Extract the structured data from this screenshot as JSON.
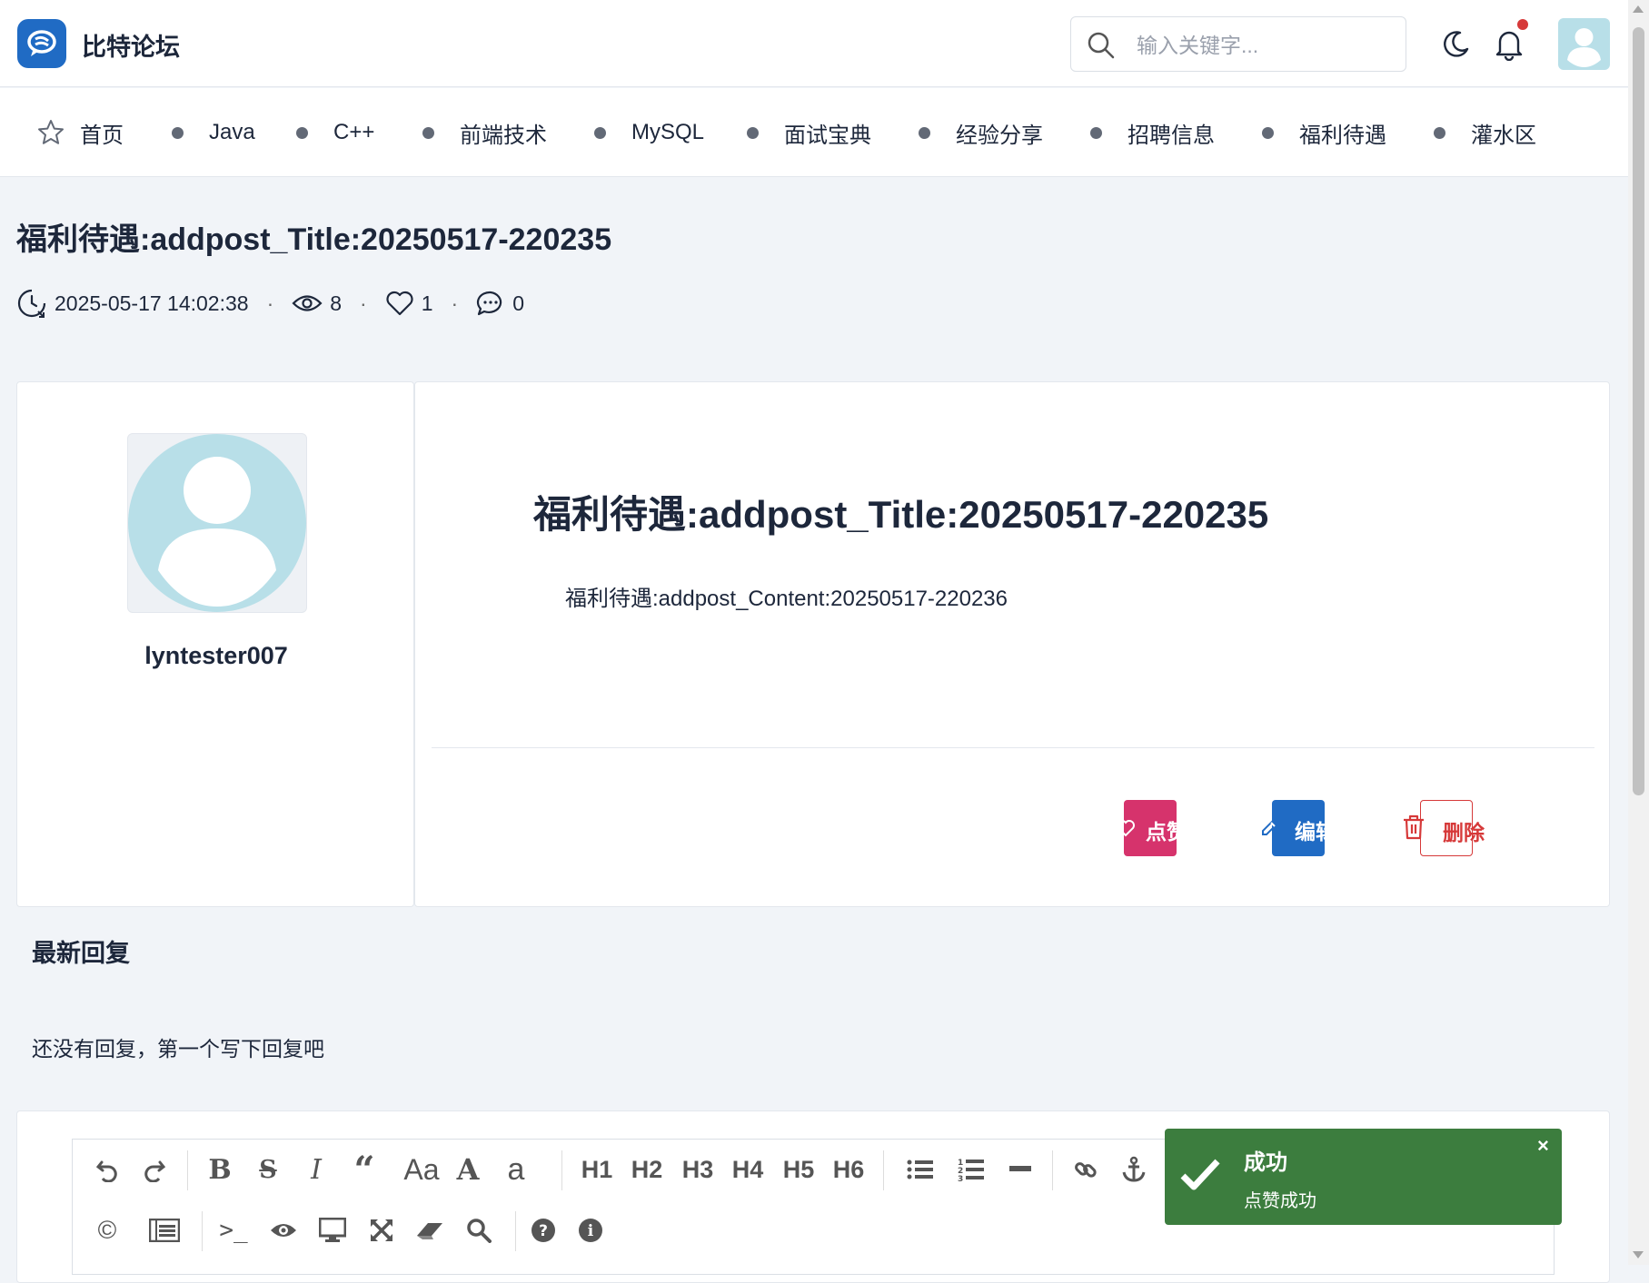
{
  "header": {
    "brand": "比特论坛",
    "search_placeholder": "输入关键字..."
  },
  "nav": {
    "home": "首页",
    "items": [
      "Java",
      "C++",
      "前端技术",
      "MySQL",
      "面试宝典",
      "经验分享",
      "招聘信息",
      "福利待遇",
      "灌水区"
    ]
  },
  "post": {
    "title": "福利待遇:addpost_Title:20250517-220235",
    "time": "2025-05-17 14:02:38",
    "views": "8",
    "likes": "1",
    "comments": "0",
    "meta_separator": "·",
    "author": "lyntester007",
    "content_title": "福利待遇:addpost_Title:20250517-220235",
    "content": "福利待遇:addpost_Content:20250517-220236",
    "like_button": "点赞",
    "edit_button": "编辑",
    "delete_button": "删除"
  },
  "replies": {
    "title": "最新回复",
    "empty_text": "还没有回复，第一个写下回复吧"
  },
  "editor": {
    "row1": [
      "undo-icon",
      "redo-icon",
      "bold-icon",
      "strikethrough-icon",
      "italic-icon",
      "quote-icon",
      "uppercase-icon",
      "font-size-icon",
      "lowercase-icon",
      "H1",
      "H2",
      "H3",
      "H4",
      "H5",
      "H6",
      "unordered-list-icon",
      "ordered-list-icon",
      "horizontal-rule-icon",
      "link-icon",
      "anchor-icon"
    ],
    "row2": [
      "copyright-icon",
      "table-icon",
      "code-icon",
      "preview-icon",
      "desktop-icon",
      "fullscreen-icon",
      "eraser-icon",
      "search-icon",
      "help-icon",
      "info-icon"
    ]
  },
  "toast": {
    "title": "成功",
    "message": "点赞成功",
    "close": "×"
  },
  "colors": {
    "primary": "#206bc4",
    "like": "#d6336c",
    "danger": "#d63939",
    "success": "#3c7d3e",
    "page_bg": "#f1f4f8"
  }
}
